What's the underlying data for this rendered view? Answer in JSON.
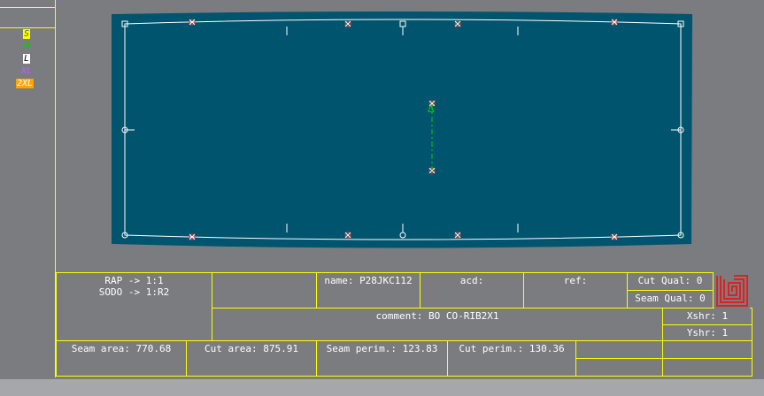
{
  "sizes": [
    {
      "label": "S",
      "bg": "#ffff00",
      "color": "#5a5a5a"
    },
    {
      "label": "M",
      "bg": "none",
      "color": "#00d000"
    },
    {
      "label": "L",
      "bg": "#ffffff",
      "color": "#000000"
    },
    {
      "label": "XL",
      "bg": "none",
      "color": "#c060ff"
    },
    {
      "label": "2XL",
      "bg": "#ffa500",
      "color": "#ffffff"
    }
  ],
  "colors": {
    "piece_fill": "#00546e",
    "outline": "#ffffff",
    "accent": "#ffff00",
    "grain_line": "#00d000",
    "notch": "#ff3030"
  },
  "info": {
    "rap": "RAP -> 1:1",
    "sodo": "SODO -> 1:R2",
    "name": "name: P28JKC112",
    "acd": "acd:",
    "ref": "ref:",
    "cut_qual": "Cut Qual: 0",
    "seam_qual": "Seam Qual: 0",
    "comment": "comment: BO CO-RIB2X1",
    "xshr": "Xshr: 1",
    "yshr": "Yshr: 1",
    "seam_area": "Seam area: 770.68",
    "cut_area": "Cut area: 875.91",
    "seam_perim": "Seam perim.: 123.83",
    "cut_perim": "Cut perim.: 130.36"
  },
  "icons": {
    "logo": "lectra-logo-icon"
  }
}
